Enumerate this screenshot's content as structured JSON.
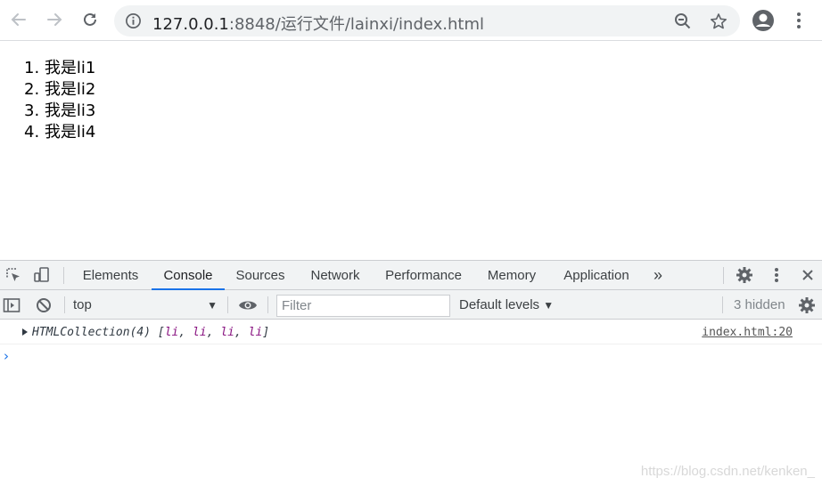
{
  "browser": {
    "url_host": "127.0.0.1",
    "url_rest": ":8848/运行文件/lainxi/index.html"
  },
  "page": {
    "list_items": [
      "1. 我是li1",
      "2. 我是li2",
      "3. 我是li3",
      "4. 我是li4"
    ]
  },
  "devtools": {
    "tabs": [
      "Elements",
      "Console",
      "Sources",
      "Network",
      "Performance",
      "Memory",
      "Application"
    ],
    "more_tabs": "»",
    "active_tab": "Console",
    "context": "top",
    "filter_placeholder": "Filter",
    "levels": "Default levels",
    "hidden_count": "3 hidden",
    "log": {
      "prefix": "HTMLCollection(4) [",
      "items": [
        "li",
        "li",
        "li",
        "li"
      ],
      "suffix": "]",
      "source": "index.html:20"
    },
    "prompt": "›"
  },
  "watermark": "https://blog.csdn.net/kenken_",
  "colors": {
    "accent": "#1a73e8",
    "toolbar_bg": "#f1f3f4",
    "collection_item": "#881280"
  }
}
